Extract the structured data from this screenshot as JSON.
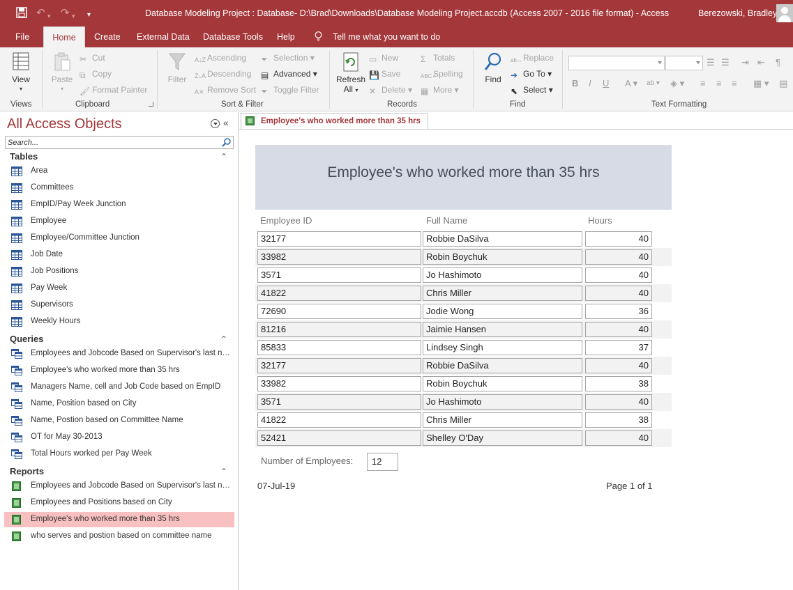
{
  "window": {
    "title": "Database Modeling Project : Database- D:\\Brad\\Downloads\\Database Modeling Project.accdb (Access 2007 - 2016 file format)  -  Access",
    "user": "Berezowski, Bradley"
  },
  "menu": {
    "tabs": [
      "File",
      "Home",
      "Create",
      "External Data",
      "Database Tools",
      "Help"
    ],
    "active": "Home",
    "tell_me": "Tell me what you want to do"
  },
  "ribbon": {
    "views": {
      "label": "Views",
      "view": "View"
    },
    "clipboard": {
      "label": "Clipboard",
      "paste": "Paste",
      "cut": "Cut",
      "copy": "Copy",
      "format_painter": "Format Painter"
    },
    "sort_filter": {
      "label": "Sort & Filter",
      "filter": "Filter",
      "ascending": "Ascending",
      "descending": "Descending",
      "remove_sort": "Remove Sort",
      "selection": "Selection",
      "advanced": "Advanced",
      "toggle_filter": "Toggle Filter"
    },
    "records": {
      "label": "Records",
      "refresh_all_line1": "Refresh",
      "refresh_all_line2": "All",
      "new": "New",
      "save": "Save",
      "delete": "Delete",
      "totals": "Totals",
      "spelling": "Spelling",
      "more": "More"
    },
    "find": {
      "label": "Find",
      "find": "Find",
      "replace": "Replace",
      "go_to": "Go To",
      "select": "Select"
    },
    "text_formatting": {
      "label": "Text Formatting"
    }
  },
  "nav": {
    "title": "All Access Objects",
    "search_placeholder": "Search...",
    "sections": [
      {
        "label": "Tables",
        "items": [
          "Area",
          "Committees",
          "EmpID/Pay Week Junction",
          "Employee",
          "Employee/Committee Junction",
          "Job Date",
          "Job Positions",
          "Pay Week",
          "Supervisors",
          "Weekly Hours"
        ]
      },
      {
        "label": "Queries",
        "items": [
          "Employees and Jobcode Based on Supervisor's last name",
          "Employee's who worked more than 35 hrs",
          "Managers Name, cell and Job Code based on EmpID",
          "Name, Position based on City",
          "Name, Postion based on Committee Name",
          "OT for May 30-2013",
          "Total Hours worked per Pay Week"
        ]
      },
      {
        "label": "Reports",
        "items": [
          "Employees and Jobcode Based on Supervisor's last name",
          "Employees and Positions based on City",
          "Employee's who worked more than 35 hrs",
          "who serves and postion based on committee name"
        ]
      }
    ],
    "selected_report": "Employee's who worked more than 35 hrs"
  },
  "document": {
    "tab_label": "Employee's who worked more than 35 hrs",
    "report": {
      "title": "Employee's who worked more than 35 hrs",
      "columns": [
        "Employee ID",
        "Full Name",
        "Hours"
      ],
      "rows": [
        [
          "32177",
          "Robbie DaSilva",
          "40"
        ],
        [
          "33982",
          "Robin Boychuk",
          "40"
        ],
        [
          "3571",
          "Jo Hashimoto",
          "40"
        ],
        [
          "41822",
          "Chris Miller",
          "40"
        ],
        [
          "72690",
          "Jodie Wong",
          "36"
        ],
        [
          "81216",
          "Jaimie Hansen",
          "40"
        ],
        [
          "85833",
          "Lindsey Singh",
          "37"
        ],
        [
          "32177",
          "Robbie DaSilva",
          "40"
        ],
        [
          "33982",
          "Robin Boychuk",
          "38"
        ],
        [
          "3571",
          "Jo Hashimoto",
          "40"
        ],
        [
          "41822",
          "Chris Miller",
          "38"
        ],
        [
          "52421",
          "Shelley O'Day",
          "40"
        ]
      ],
      "count_label": "Number of Employees:",
      "count_value": "12",
      "date": "07-Jul-19",
      "page": "Page 1 of 1"
    }
  },
  "colors": {
    "accent": "#a4373a",
    "header_band": "#d6dbe5",
    "selection": "#f8c0c0"
  }
}
